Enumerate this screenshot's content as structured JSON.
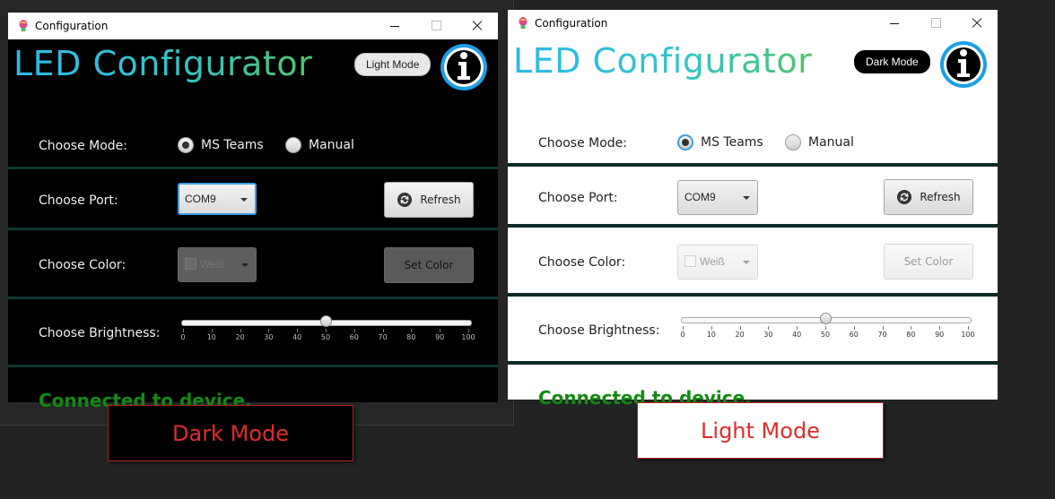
{
  "windows": [
    {
      "theme": "dark",
      "title": "Configuration",
      "heading": "LED Configurator",
      "mode_toggle_label": "Light Mode",
      "rows": {
        "mode": {
          "label": "Choose Mode:",
          "options": [
            "MS Teams",
            "Manual"
          ],
          "selected": "MS Teams"
        },
        "port": {
          "label": "Choose Port:",
          "value": "COM9",
          "button": "Refresh"
        },
        "color": {
          "label": "Choose Color:",
          "value": "Weiß",
          "button": "Set Color"
        },
        "brightness": {
          "label": "Choose Brightness:",
          "value": 50,
          "min": 0,
          "max": 100,
          "ticks": [
            "0",
            "10",
            "20",
            "30",
            "40",
            "50",
            "60",
            "70",
            "80",
            "90",
            "100"
          ]
        }
      },
      "status": "Connected to device."
    },
    {
      "theme": "light",
      "title": "Configuration",
      "heading": "LED Configurator",
      "mode_toggle_label": "Dark Mode",
      "rows": {
        "mode": {
          "label": "Choose Mode:",
          "options": [
            "MS Teams",
            "Manual"
          ],
          "selected": "MS Teams"
        },
        "port": {
          "label": "Choose Port:",
          "value": "COM9",
          "button": "Refresh"
        },
        "color": {
          "label": "Choose Color:",
          "value": "Weiß",
          "button": "Set Color"
        },
        "brightness": {
          "label": "Choose Brightness:",
          "value": 50,
          "min": 0,
          "max": 100,
          "ticks": [
            "0",
            "10",
            "20",
            "30",
            "40",
            "50",
            "60",
            "70",
            "80",
            "90",
            "100"
          ]
        }
      },
      "status": "Connected to device."
    }
  ],
  "captions": {
    "dark": "Dark Mode",
    "light": "Light Mode"
  },
  "colors": {
    "accent_blue": "#2fb8ea",
    "status_green": "#138a13",
    "caption_red": "#e22b2b",
    "focus_blue": "#3aa0e6"
  }
}
